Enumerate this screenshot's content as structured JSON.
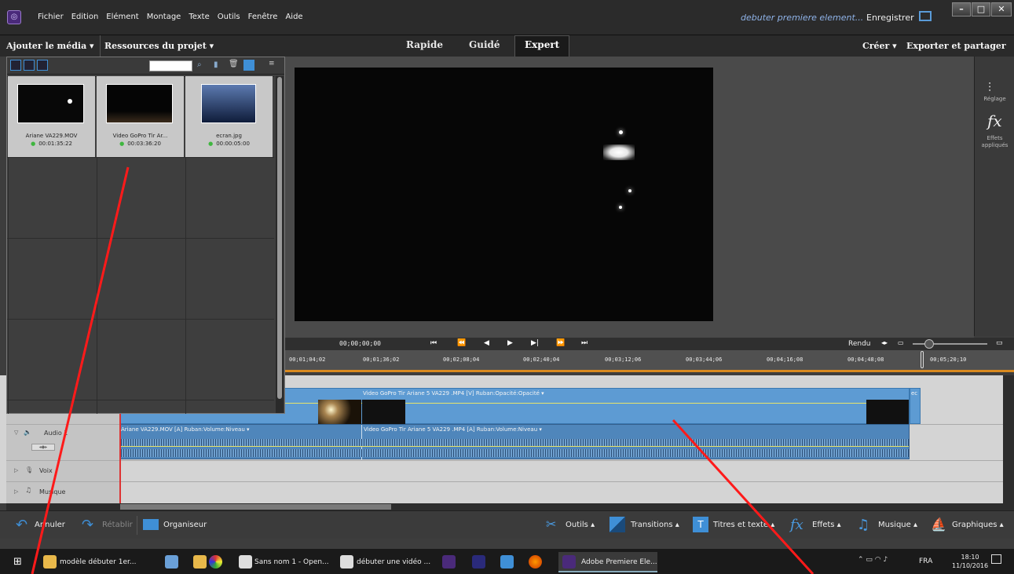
{
  "menu": {
    "items": [
      "Fichier",
      "Edition",
      "Elément",
      "Montage",
      "Texte",
      "Outils",
      "Fenêtre",
      "Aide"
    ],
    "doc_title": "debuter premiere element...",
    "save_label": "Enregistrer"
  },
  "modebar": {
    "add_media": "Ajouter le média ▾",
    "project_resources": "Ressources du projet ▾",
    "tabs": [
      "Rapide",
      "Guidé",
      "Expert"
    ],
    "active_tab": "Expert",
    "create": "Créer ▾",
    "export": "Exporter et partager"
  },
  "right_panel": {
    "adjust_label": "Réglage",
    "effects_label": "Effets appliqués"
  },
  "media": {
    "items": [
      {
        "name": "Ariane VA229.MOV",
        "duration": "00:01:35:22"
      },
      {
        "name": "Video GoPro Tir Ar...",
        "duration": "00:03:36:20"
      },
      {
        "name": "ecran.jpg",
        "duration": "00:00:05:00"
      }
    ]
  },
  "transport": {
    "timecode": "00;00;00;00",
    "render_label": "Rendu"
  },
  "ruler": {
    "labels": [
      "00;01;04;02",
      "00;01;36;02",
      "00;02;08;04",
      "00;02;40;04",
      "00;03;12;06",
      "00;03;44;06",
      "00;04;16;08",
      "00;04;48;08",
      "00;05;20;10"
    ]
  },
  "timeline": {
    "video_clip_label": "Video GoPro Tir Ariane 5 VA229 .MP4 [V] Ruban:Opacité:Opacité ▾",
    "video_clip_end_label": "ec",
    "audio_clip_a_label": "Ariane VA229.MOV [A] Ruban:Volume:Niveau ▾",
    "audio_clip_b_label": "Video GoPro Tir Ariane 5 VA229 .MP4 [A] Ruban:Volume:Niveau ▾",
    "tracks": [
      {
        "name": "Audio 1"
      },
      {
        "name": "Voix"
      },
      {
        "name": "Musique"
      }
    ]
  },
  "actionbar": {
    "undo": "Annuler",
    "redo": "Rétablir",
    "organizer": "Organiseur",
    "tools": "Outils ▴",
    "transitions": "Transitions ▴",
    "titles": "Titres et texte ▴",
    "effects": "Effets ▴",
    "music": "Musique ▴",
    "graphics": "Graphiques ▴"
  },
  "taskbar": {
    "tasks": [
      "modèle débuter 1er...",
      "Sans nom 1 - Open...",
      "débuter une vidéo ...",
      "Adobe Premiere Ele..."
    ],
    "lang": "FRA",
    "time": "18:10",
    "date": "11/10/2016"
  }
}
